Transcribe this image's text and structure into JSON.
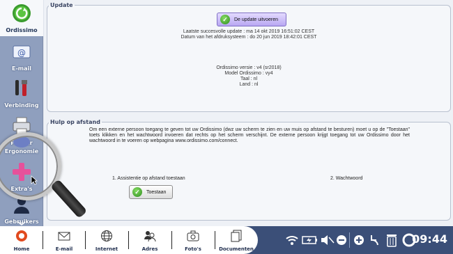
{
  "sidebar": {
    "items": [
      {
        "label": "Ordissimo",
        "icon": "ordissimo-logo-icon",
        "active": true
      },
      {
        "label": "E-mail",
        "icon": "email-icon"
      },
      {
        "label": "Verbinding",
        "icon": "connection-tools-icon"
      },
      {
        "label": "Printer",
        "icon": "printer-icon"
      },
      {
        "label": "Ergonomie",
        "icon": "ergonomics-icon"
      },
      {
        "label": "Extra's",
        "icon": "plus-icon"
      },
      {
        "label": "Gebruikers",
        "icon": "users-icon"
      }
    ]
  },
  "update": {
    "legend": "Update",
    "button_label": "De update uitvoeren",
    "last_update": "Laatste succesvolle update : ma 14 okt 2019 16:51:02 CEST",
    "print_date": "Datum van het afdruksysteem : do 20 jun 2019 18:42:01 CEST",
    "version": "Ordissimo versie : v4 (sr2018)",
    "model": "Model Ordissimo : vy4",
    "language": "Taal : nl",
    "country": "Land : nl"
  },
  "remote": {
    "legend": "Hulp op afstand",
    "paragraph": "Om een externe persoon toegang te geven tot uw Ordissimo (dwz uw scherm te zien en uw muis op afstand te besturen) moet u op de \"Toestaan\" toets klikken en het wachtwoord invoeren dat rechts op het scherm verschijnt. De externe persoon krijgt toegang tot uw Ordissimo door het wachtwoord in te voeren op webpagina www.ordissimo.com/connect.",
    "step1": "1. Assistentie op afstand toestaan",
    "step2": "2. Wachtwoord",
    "allow_button": "Toestaan"
  },
  "taskbar": {
    "items": [
      {
        "label": "Home",
        "icon": "home-icon"
      },
      {
        "label": "E-mail",
        "icon": "envelope-icon"
      },
      {
        "label": "Internet",
        "icon": "globe-icon"
      },
      {
        "label": "Adres",
        "icon": "contacts-icon"
      },
      {
        "label": "Foto's",
        "icon": "camera-icon"
      },
      {
        "label": "Documenten",
        "icon": "documents-icon"
      }
    ],
    "clock": "09:44"
  },
  "colors": {
    "sidebar_bg": "#8f9fbe",
    "taskbar_bg": "#3b4f78",
    "primary_button": "#b8a7f2"
  }
}
